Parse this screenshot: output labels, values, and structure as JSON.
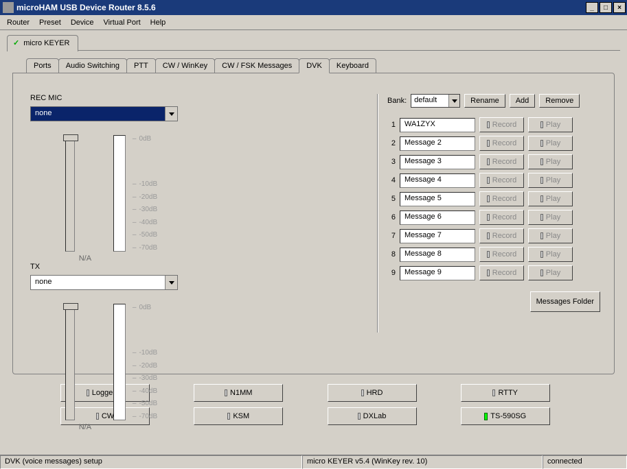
{
  "window": {
    "title": "microHAM USB Device Router 8.5.6"
  },
  "menu": {
    "router": "Router",
    "preset": "Preset",
    "device": "Device",
    "vport": "Virtual Port",
    "help": "Help"
  },
  "device_tab": "micro KEYER",
  "tabs": {
    "ports": "Ports",
    "audio": "Audio Switching",
    "ptt": "PTT",
    "cwwk": "CW / WinKey",
    "cwfsk": "CW / FSK Messages",
    "dvk": "DVK",
    "keyboard": "Keyboard"
  },
  "dvk": {
    "rec_mic_label": "REC MIC",
    "rec_mic_value": "none",
    "tx_label": "TX",
    "tx_value": "none",
    "na": "N/A",
    "ticks": {
      "t0": "0dB",
      "t10": "-10dB",
      "t20": "-20dB",
      "t30": "-30dB",
      "t40": "-40dB",
      "t50": "-50dB",
      "t70": "-70dB"
    }
  },
  "bank": {
    "label": "Bank:",
    "value": "default",
    "rename": "Rename",
    "add": "Add",
    "remove": "Remove"
  },
  "messages": [
    {
      "idx": "1",
      "text": "WA1ZYX"
    },
    {
      "idx": "2",
      "text": "Message 2"
    },
    {
      "idx": "3",
      "text": "Message 3"
    },
    {
      "idx": "4",
      "text": "Message 4"
    },
    {
      "idx": "5",
      "text": "Message 5"
    },
    {
      "idx": "6",
      "text": "Message 6"
    },
    {
      "idx": "7",
      "text": "Message 7"
    },
    {
      "idx": "8",
      "text": "Message 8"
    },
    {
      "idx": "9",
      "text": "Message 9"
    }
  ],
  "msg_buttons": {
    "record": "Record",
    "play": "Play",
    "folder": "Messages Folder"
  },
  "bottom": {
    "logger32": "Logger32",
    "n1mm": "N1MM",
    "hrd": "HRD",
    "rtty": "RTTY",
    "cw": "CW",
    "ksm": "KSM",
    "dxlab": "DXLab",
    "ts590": "TS-590SG"
  },
  "status": {
    "left": "DVK (voice messages) setup",
    "mid": "micro KEYER v5.4 (WinKey rev. 10)",
    "right": "connected"
  }
}
